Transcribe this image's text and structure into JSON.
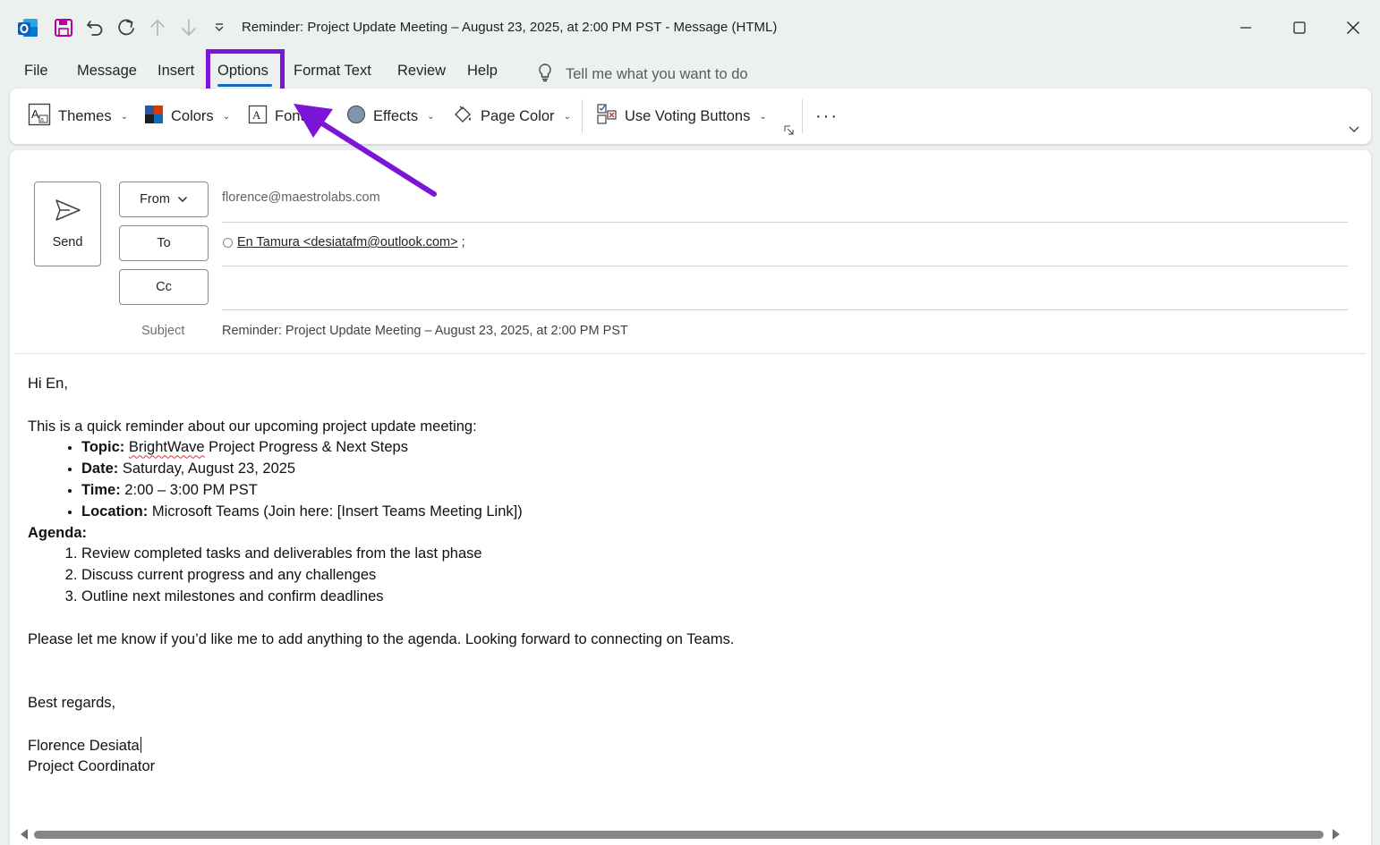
{
  "window": {
    "title": "Reminder: Project Update Meeting – August 23, 2025, at 2:00 PM PST  -  Message (HTML)"
  },
  "menu": {
    "tabs": [
      {
        "label": "File"
      },
      {
        "label": "Message"
      },
      {
        "label": "Insert"
      },
      {
        "label": "Options",
        "active": true
      },
      {
        "label": "Format Text"
      },
      {
        "label": "Review"
      },
      {
        "label": "Help"
      }
    ],
    "tell_me": "Tell me what you want to do"
  },
  "ribbon": {
    "themes": "Themes",
    "colors": "Colors",
    "fonts": "Fonts",
    "effects": "Effects",
    "page_color": "Page Color",
    "voting": "Use Voting Buttons",
    "more": "···"
  },
  "compose": {
    "send_label": "Send",
    "from_label": "From",
    "to_label": "To",
    "cc_label": "Cc",
    "from_value": "florence@maestrolabs.com",
    "to_recipient": "En Tamura <desiatafm@outlook.com>",
    "to_separator": ";",
    "subject_label": "Subject",
    "subject_value": "Reminder: Project Update Meeting – August 23, 2025, at 2:00 PM PST"
  },
  "body": {
    "greeting": "Hi En,",
    "intro": "This is a quick reminder about our upcoming project update meeting:",
    "details": [
      {
        "label": "Topic:",
        "pre": "",
        "spell": "BrightWave",
        "value": " Project Progress & Next Steps"
      },
      {
        "label": "Date:",
        "value": " Saturday, August 23, 2025"
      },
      {
        "label": "Time:",
        "value": " 2:00 – 3:00 PM PST"
      },
      {
        "label": "Location:",
        "value": " Microsoft Teams (Join here: [Insert Teams Meeting Link])"
      }
    ],
    "agenda_label": "Agenda:",
    "agenda": [
      "Review completed tasks and deliverables from the last phase",
      "Discuss current progress and any challenges",
      "Outline next milestones and confirm deadlines"
    ],
    "closing_line": "Please let me know if you’d like me to add anything to the agenda. Looking forward to connecting on Teams.",
    "signoff": "Best regards,",
    "sig_name": "Florence Desiata",
    "sig_title": "Project Coordinator"
  },
  "colors": {
    "accent": "#0f6cbd",
    "annotation": "#7b16d9",
    "outlook_blue": "#0f6cbd",
    "save_icon": "#b4009e"
  }
}
